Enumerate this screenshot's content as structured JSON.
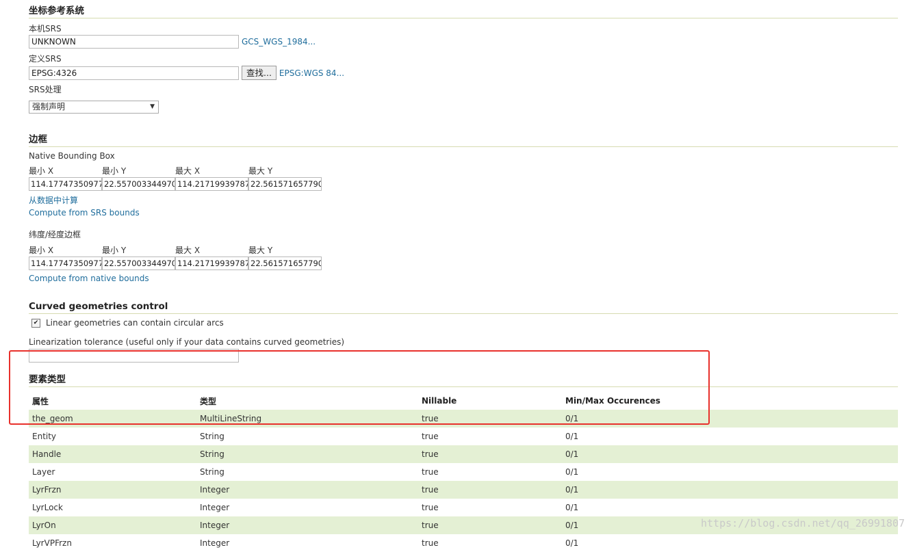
{
  "crs": {
    "title": "坐标参考系统",
    "native_label": "本机SRS",
    "native_value": "UNKNOWN",
    "native_link": "GCS_WGS_1984...",
    "declared_label": "定义SRS",
    "declared_value": "EPSG:4326",
    "find_button": "查找...",
    "declared_link": "EPSG:WGS 84...",
    "handling_label": "SRS处理",
    "handling_value": "强制声明"
  },
  "bbox": {
    "title": "边框",
    "native_label": "Native Bounding Box",
    "cols": [
      "最小 X",
      "最小 Y",
      "最大 X",
      "最大 Y"
    ],
    "native_values": [
      "114.17747350977",
      "22.557003344970",
      "114.21719939787",
      "22.561571657790"
    ],
    "compute_data": "从数据中计算",
    "compute_srs": "Compute from SRS bounds",
    "latlon_label": "纬度/经度边框",
    "latlon_values": [
      "114.17747350977",
      "22.557003344970",
      "114.21719939787",
      "22.561571657790"
    ],
    "compute_native": "Compute from native bounds"
  },
  "curved": {
    "title": "Curved geometries control",
    "checkbox_label": "Linear geometries can contain circular arcs",
    "checked": true,
    "tolerance_label": "Linearization tolerance (useful only if your data contains curved geometries)",
    "tolerance_value": ""
  },
  "feature": {
    "title": "要素类型",
    "headers": [
      "属性",
      "类型",
      "Nillable",
      "Min/Max Occurences"
    ],
    "rows": [
      [
        "the_geom",
        "MultiLineString",
        "true",
        "0/1"
      ],
      [
        "Entity",
        "String",
        "true",
        "0/1"
      ],
      [
        "Handle",
        "String",
        "true",
        "0/1"
      ],
      [
        "Layer",
        "String",
        "true",
        "0/1"
      ],
      [
        "LyrFrzn",
        "Integer",
        "true",
        "0/1"
      ],
      [
        "LyrLock",
        "Integer",
        "true",
        "0/1"
      ],
      [
        "LyrOn",
        "Integer",
        "true",
        "0/1"
      ],
      [
        "LyrVPFrzn",
        "Integer",
        "true",
        "0/1"
      ]
    ]
  },
  "watermark": "https://blog.csdn.net/qq_26991807",
  "colors": {
    "link": "#1f6d9c",
    "row_highlight": "#e4f0d4",
    "annotation": "#e8302b"
  }
}
